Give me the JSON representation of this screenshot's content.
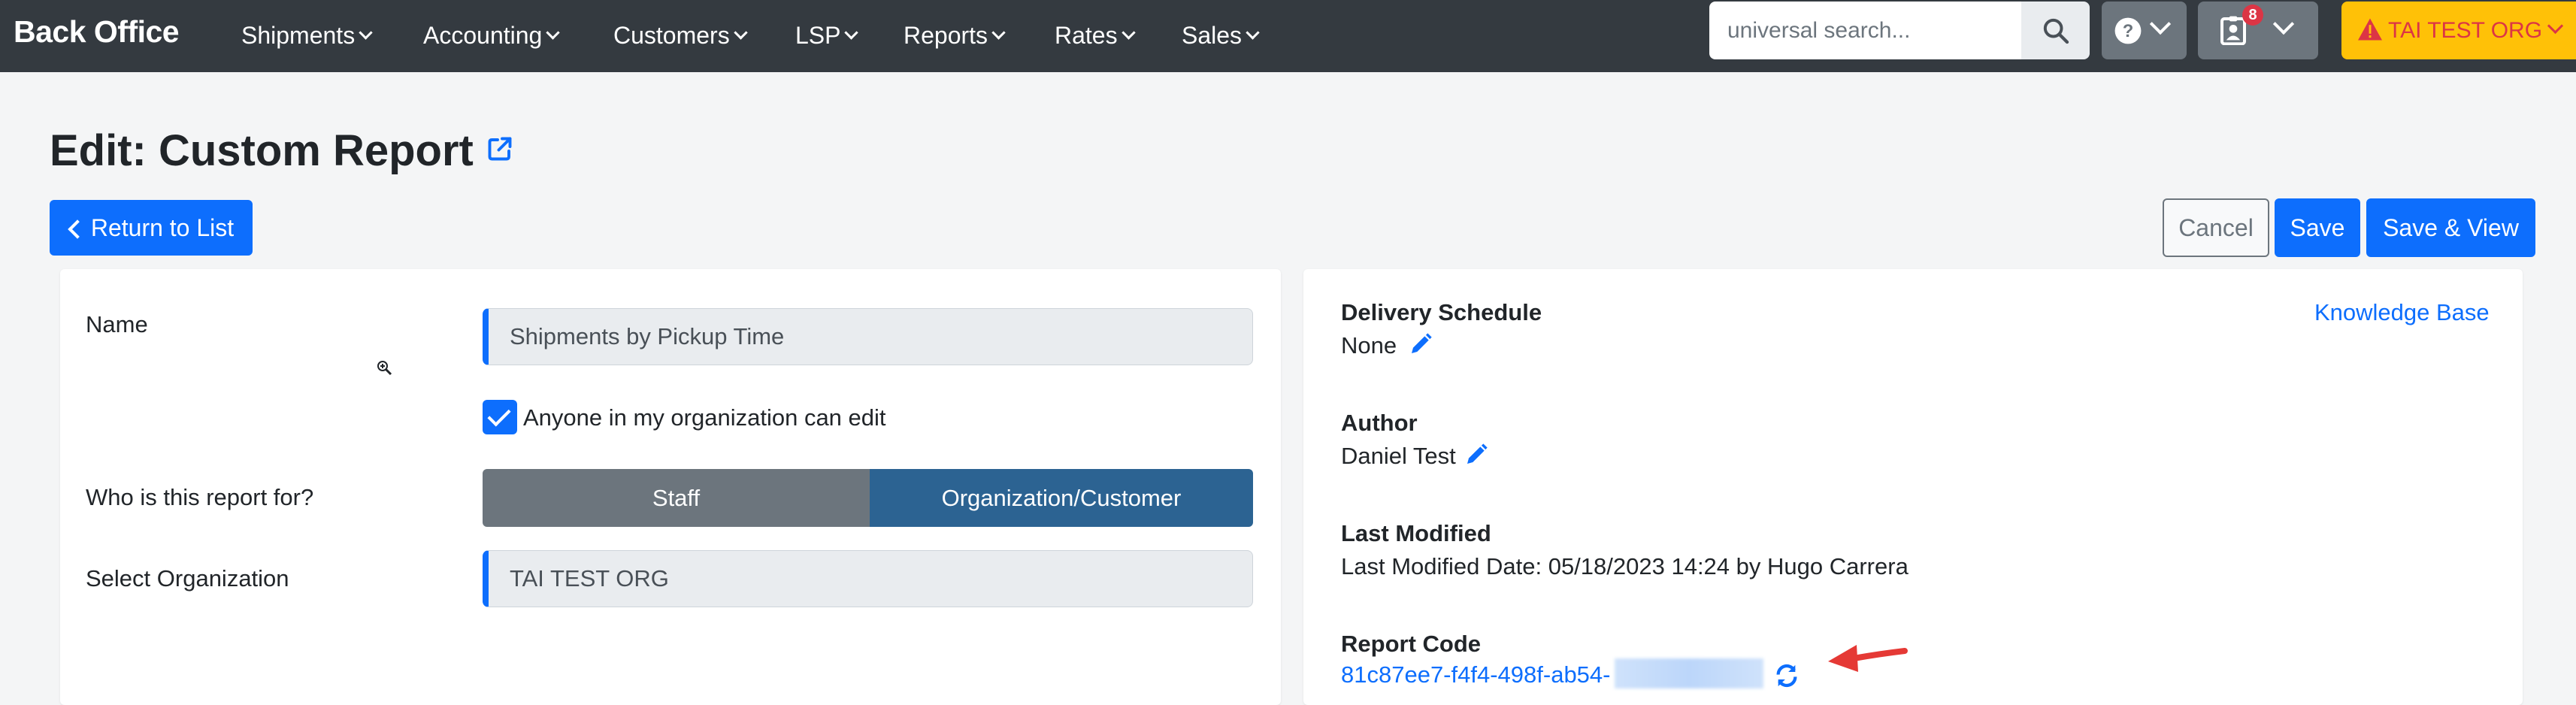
{
  "app": {
    "title": "Back Office"
  },
  "nav": {
    "items": [
      {
        "label": "Shipments"
      },
      {
        "label": "Accounting"
      },
      {
        "label": "Customers"
      },
      {
        "label": "LSP"
      },
      {
        "label": "Reports"
      },
      {
        "label": "Rates"
      },
      {
        "label": "Sales"
      }
    ]
  },
  "search": {
    "placeholder": "universal search..."
  },
  "help": {
    "icon": "question-circle-icon"
  },
  "notifications": {
    "icon": "user-badge-icon",
    "count": "8"
  },
  "org": {
    "label": "TAI TEST ORG",
    "icon": "warning-triangle-icon"
  },
  "page": {
    "title": "Edit: Custom Report",
    "title_icon": "external-link-icon"
  },
  "actions": {
    "return_label": "Return to List",
    "cancel_label": "Cancel",
    "save_label": "Save",
    "save_view_label": "Save & View"
  },
  "form": {
    "name_label": "Name",
    "name_value": "Shipments by Pickup Time",
    "edit_checkbox_label": "Anyone in my organization can edit",
    "edit_checkbox_checked": true,
    "audience_label": "Who is this report for?",
    "audience_options": [
      "Staff",
      "Organization/Customer"
    ],
    "audience_selected": "Organization/Customer",
    "org_label": "Select Organization",
    "org_value": "TAI TEST ORG"
  },
  "details": {
    "kb_link": "Knowledge Base",
    "delivery_heading": "Delivery Schedule",
    "delivery_value": "None",
    "author_heading": "Author",
    "author_value": "Daniel Test",
    "modified_heading": "Last Modified",
    "modified_value": "Last Modified Date: 05/18/2023 14:24 by Hugo Carrera",
    "code_heading": "Report Code",
    "code_value": "81c87ee7-f4f4-498f-ab54-"
  },
  "colors": {
    "navbar": "#343a40",
    "primary": "#0d6efd",
    "toggle_selected": "#2c6392",
    "toggle_unselected": "#6c757d",
    "org_button": "#ffc107",
    "alert": "#dc3545"
  }
}
